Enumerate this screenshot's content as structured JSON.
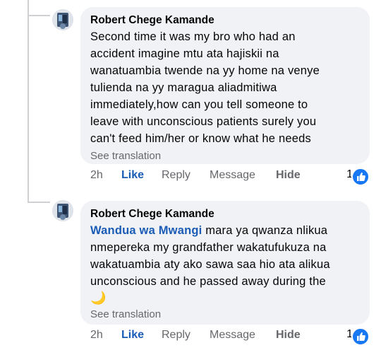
{
  "comments": [
    {
      "author": "Robert Chege Kamande",
      "text_lines": [
        "Second time it was my bro who had an",
        "accident imagine mtu ata hajiskii na",
        "wanatuambia twende na yy home na venye",
        "tulienda na yy maragua aliadmitiwa",
        "immediately,how can you tell someone to",
        "leave with unconscious patients surely you",
        "can't feed him/her or know what he needs"
      ],
      "see_translation": "See translation",
      "time": "2h",
      "like": "Like",
      "reply": "Reply",
      "message": "Message",
      "hide": "Hide",
      "reaction_count": "1"
    },
    {
      "author": "Robert Chege Kamande",
      "mention": "Wandua wa Mwangi",
      "first_line_rest": " mara ya qwanza nlikua",
      "text_lines": [
        "nmepereka my grandfather wakatufukuza na",
        "wakatuambia aty ako sawa saa hio ata alikua",
        "unconscious and he passed away during the"
      ],
      "emoji": "🌙",
      "see_translation": "See translation",
      "time": "2h",
      "like": "Like",
      "reply": "Reply",
      "message": "Message",
      "hide": "Hide",
      "reaction_count": "1"
    }
  ],
  "colors": {
    "link_blue": "#1a5bb6",
    "bubble_bg": "#f0f2f5",
    "secondary_text": "#65676b",
    "like_icon_bg": "#1877f2"
  },
  "icons": {
    "reaction": "thumbs-up-icon",
    "avatar": "profile-picture"
  }
}
